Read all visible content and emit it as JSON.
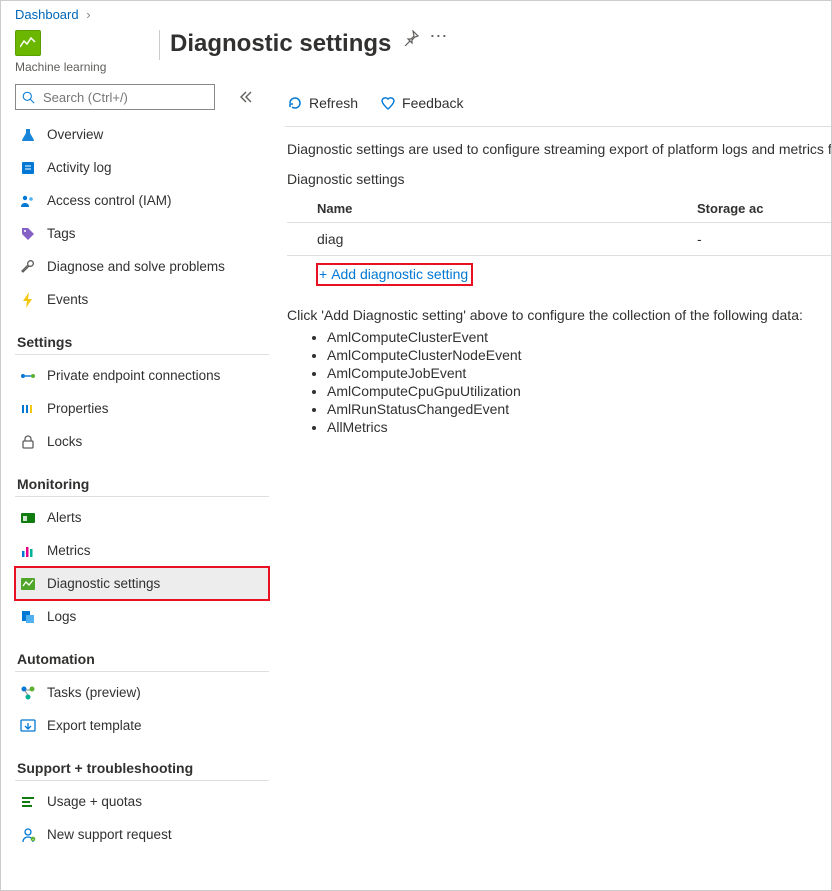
{
  "breadcrumb": {
    "home": "Dashboard"
  },
  "resource": {
    "subtitle": "Machine learning"
  },
  "page": {
    "title": "Diagnostic settings"
  },
  "search": {
    "placeholder": "Search (Ctrl+/)"
  },
  "sections": {
    "settings": "Settings",
    "monitoring": "Monitoring",
    "automation": "Automation",
    "support": "Support + troubleshooting"
  },
  "nav": {
    "overview": "Overview",
    "activity": "Activity log",
    "iam": "Access control (IAM)",
    "tags": "Tags",
    "diagnose": "Diagnose and solve problems",
    "events": "Events",
    "pep": "Private endpoint connections",
    "properties": "Properties",
    "locks": "Locks",
    "alerts": "Alerts",
    "metrics": "Metrics",
    "diagset": "Diagnostic settings",
    "logs": "Logs",
    "tasks": "Tasks (preview)",
    "export": "Export template",
    "usage": "Usage + quotas",
    "support_req": "New support request"
  },
  "toolbar": {
    "refresh": "Refresh",
    "feedback": "Feedback"
  },
  "main": {
    "description": "Diagnostic settings are used to configure streaming export of platform logs and metrics for a r",
    "subheading": "Diagnostic settings",
    "col_name": "Name",
    "col_storage": "Storage ac",
    "row_name": "diag",
    "row_storage": "-",
    "add_link": "Add diagnostic setting",
    "info": "Click 'Add Diagnostic setting' above to configure the collection of the following data:",
    "data_list": [
      "AmlComputeClusterEvent",
      "AmlComputeClusterNodeEvent",
      "AmlComputeJobEvent",
      "AmlComputeCpuGpuUtilization",
      "AmlRunStatusChangedEvent",
      "AllMetrics"
    ]
  }
}
